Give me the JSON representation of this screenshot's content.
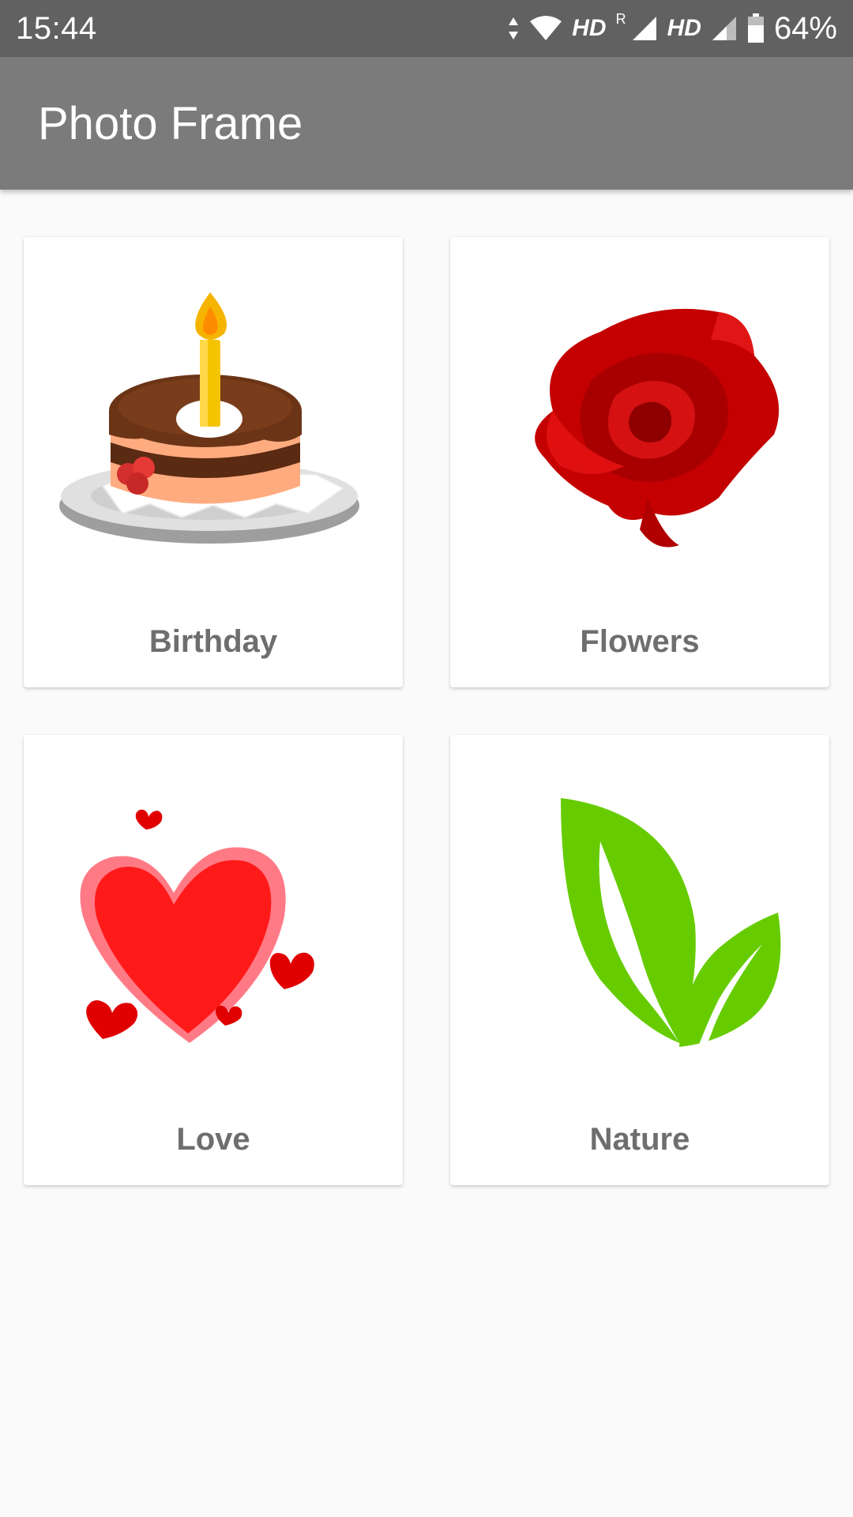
{
  "status_bar": {
    "time": "15:44",
    "hd_1": "HD",
    "roaming": "R",
    "hd_2": "HD",
    "battery": "64%",
    "icons": [
      "data-arrows-icon",
      "wifi-icon",
      "signal-icon",
      "signal-icon",
      "battery-icon"
    ]
  },
  "app_bar": {
    "title": "Photo Frame",
    "color": "#7b7b7b"
  },
  "categories": [
    {
      "label": "Birthday",
      "icon": "birthday-cake-icon"
    },
    {
      "label": "Flowers",
      "icon": "rose-icon"
    },
    {
      "label": "Love",
      "icon": "hearts-icon"
    },
    {
      "label": "Nature",
      "icon": "leaves-icon"
    }
  ],
  "colors": {
    "background": "#fafafa",
    "card": "#ffffff",
    "label": "#6e6e6e",
    "status_bar": "#616161"
  }
}
